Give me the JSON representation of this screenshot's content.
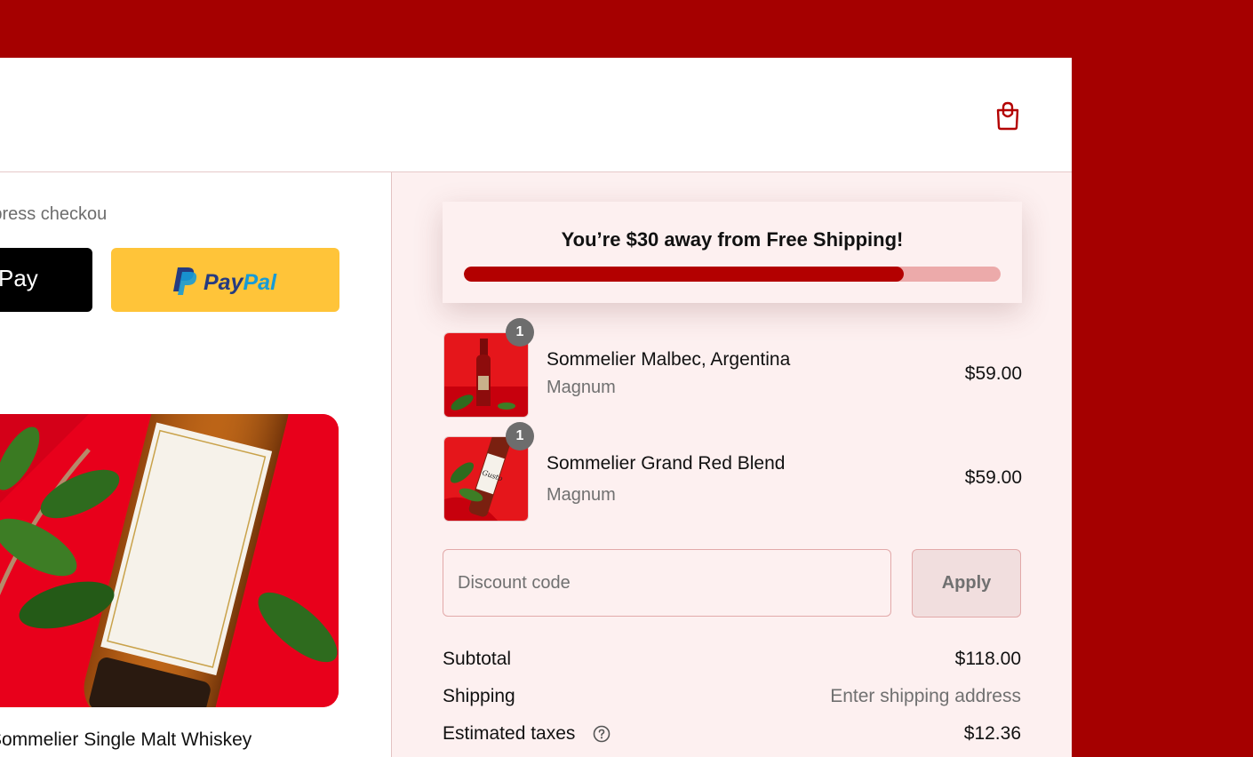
{
  "header": {
    "cart_icon": "shopping-bag-icon"
  },
  "express": {
    "label": "Express checkout",
    "apple_label": "Pay",
    "paypal_label": "PayPal"
  },
  "featured_product": {
    "name": "Sommelier Single Malt Whiskey"
  },
  "shipping_banner": {
    "message": "You’re $30 away from Free Shipping!",
    "progress": 0.82
  },
  "cart": {
    "items": [
      {
        "quantity": "1",
        "name": "Sommelier Malbec, Argentina",
        "variant": "Magnum",
        "price": "$59.00"
      },
      {
        "quantity": "1",
        "name": "Sommelier Grand Red Blend",
        "variant": "Magnum",
        "price": "$59.00"
      }
    ]
  },
  "discount": {
    "placeholder": "Discount code",
    "apply_label": "Apply"
  },
  "summary": {
    "subtotal_label": "Subtotal",
    "subtotal_value": "$118.00",
    "shipping_label": "Shipping",
    "shipping_value": "Enter shipping address",
    "taxes_label": "Estimated taxes",
    "taxes_value": "$12.36"
  },
  "colors": {
    "brand": "#a50000",
    "progress_fill": "#b30000",
    "progress_track": "#ecaaaa",
    "paypal_yellow": "#ffc439",
    "panel_bg": "#fdf0f0"
  }
}
